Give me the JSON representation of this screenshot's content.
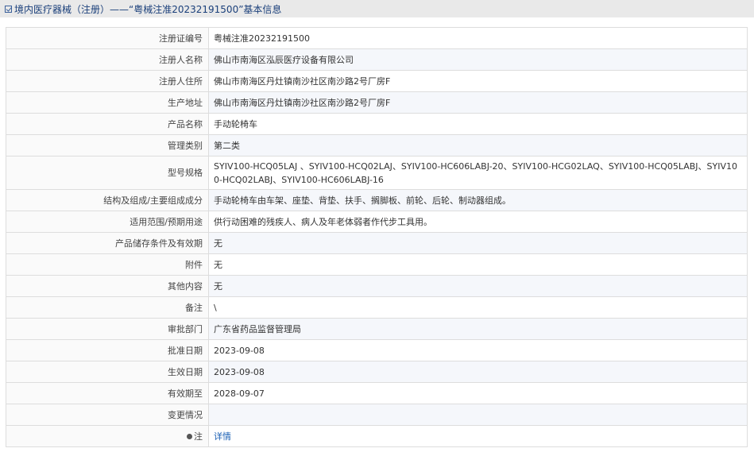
{
  "header": {
    "title": "境内医疗器械（注册）——“粤械注准20232191500”基本信息"
  },
  "rows": [
    {
      "label": "注册证编号",
      "value": "粤械注准20232191500"
    },
    {
      "label": "注册人名称",
      "value": "佛山市南海区泓辰医疗设备有限公司"
    },
    {
      "label": "注册人住所",
      "value": "佛山市南海区丹灶镇南沙社区南沙路2号厂房F"
    },
    {
      "label": "生产地址",
      "value": "佛山市南海区丹灶镇南沙社区南沙路2号厂房F"
    },
    {
      "label": "产品名称",
      "value": "手动轮椅车"
    },
    {
      "label": "管理类别",
      "value": "第二类"
    },
    {
      "label": "型号规格",
      "value": "SYIV100-HCQ05LAJ 、SYIV100-HCQ02LAJ、SYIV100-HC606LABJ-20、SYIV100-HCG02LAQ、SYIV100-HCQ05LABJ、SYIV100-HCQ02LABJ、SYIV100-HC606LABJ-16"
    },
    {
      "label": "结构及组成/主要组成成分",
      "value": "手动轮椅车由车架、座垫、背垫、扶手、搁脚板、前轮、后轮、制动器组成。"
    },
    {
      "label": "适用范围/预期用途",
      "value": "供行动困难的残疾人、病人及年老体弱者作代步工具用。"
    },
    {
      "label": "产品储存条件及有效期",
      "value": "无"
    },
    {
      "label": "附件",
      "value": "无"
    },
    {
      "label": "其他内容",
      "value": "无"
    },
    {
      "label": "备注",
      "value": "\\"
    },
    {
      "label": "审批部门",
      "value": "广东省药品监督管理局"
    },
    {
      "label": "批准日期",
      "value": "2023-09-08"
    },
    {
      "label": "生效日期",
      "value": "2023-09-08"
    },
    {
      "label": "有效期至",
      "value": "2028-09-07"
    },
    {
      "label": "变更情况",
      "value": ""
    }
  ],
  "note_row": {
    "label": "注",
    "link_text": "详情"
  },
  "colors": {
    "title_bar_bg": "#e9e9e9",
    "title_text": "#1a3f7a",
    "link": "#1a5fb4"
  }
}
